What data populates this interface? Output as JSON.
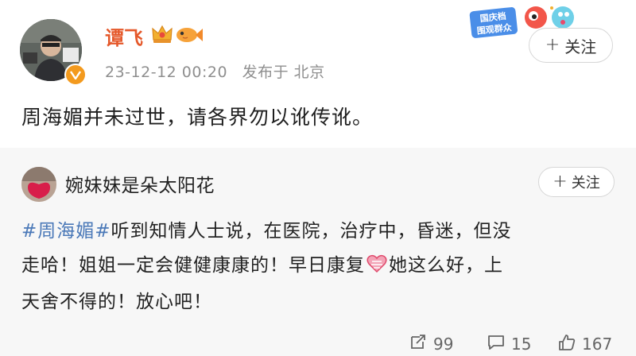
{
  "post": {
    "username": "谭飞",
    "time": "23-12-12 00:20",
    "location": "发布于 北京",
    "follow_label": "关注",
    "text": "周海媚并未过世，请各界勿以讹传讹。",
    "promo_text_1": "国庆档",
    "promo_text_2": "围观群众"
  },
  "repost": {
    "username": "婉妹妹是朵太阳花",
    "follow_label": "关注",
    "hashtag": "#周海媚#",
    "line1_rest": "听到知情人士说，在医院，治疗中，昏迷，但没",
    "line2_start": "走哈！姐姐一定会健健康康的！早日康复",
    "line2_end": "她这么好，上",
    "line3": "天舍不得的！放心吧！"
  },
  "actions": {
    "repost_count": "99",
    "comment_count": "15",
    "like_count": "167"
  },
  "colors": {
    "username_orange": "#e5592b",
    "hashtag_blue": "#4b79b8",
    "meta_gray": "#8f8f8f",
    "repost_bg": "#f7f7f7"
  },
  "icons": [
    "verified-badge-icon",
    "crown-icon",
    "fish-icon",
    "heart-emoji-icon",
    "repost-icon",
    "comment-icon",
    "like-icon"
  ]
}
